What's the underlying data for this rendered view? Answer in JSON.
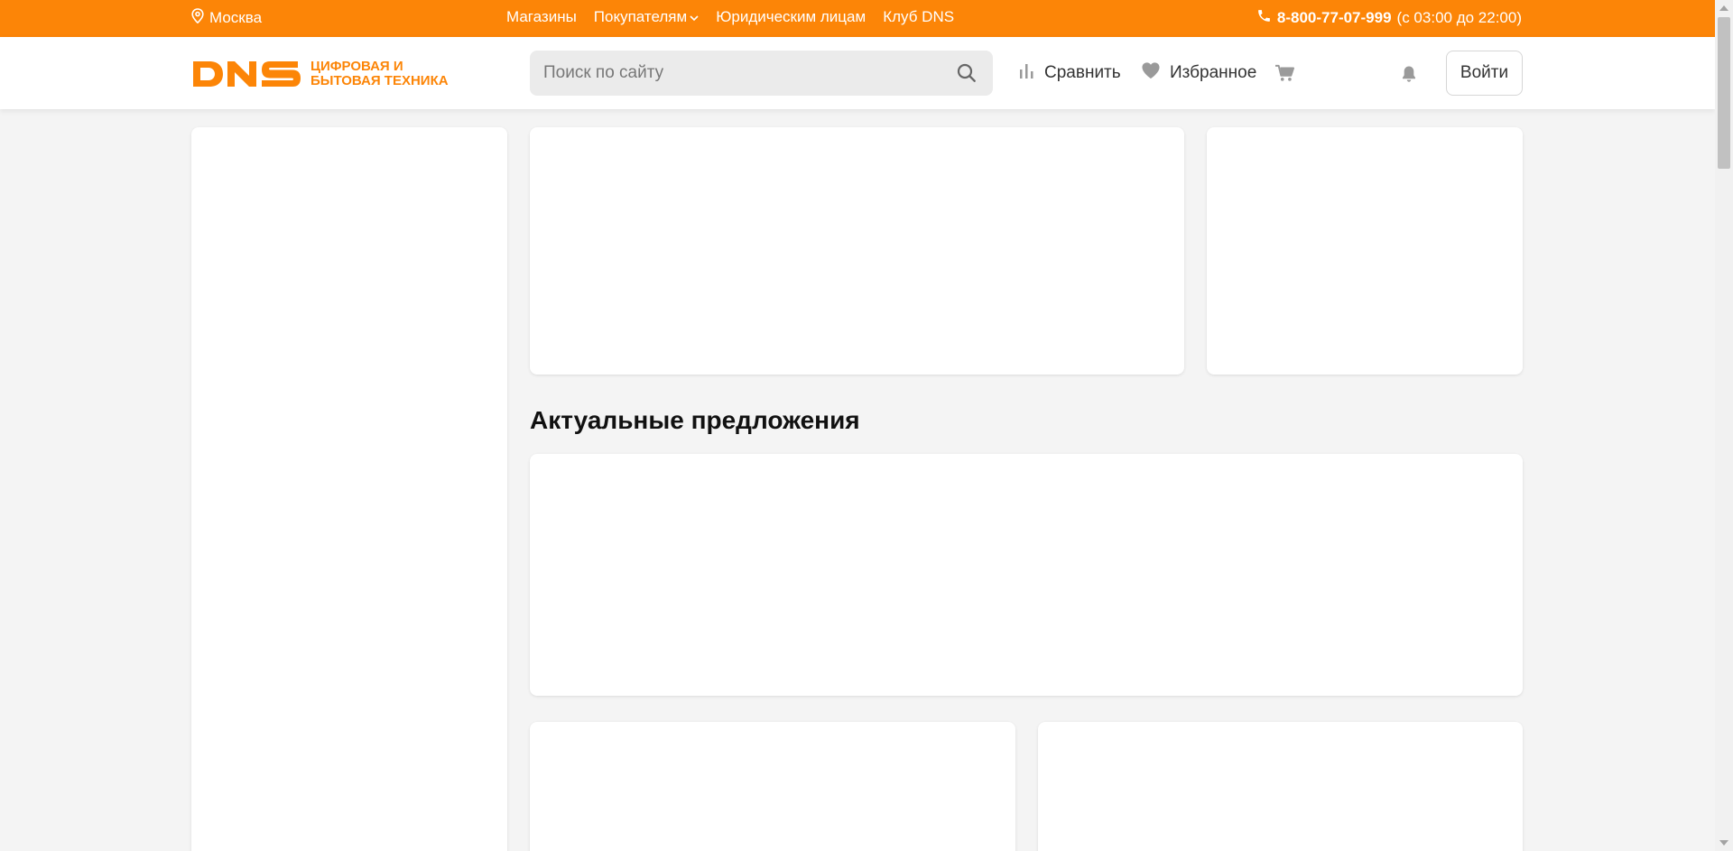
{
  "topbar": {
    "city": "Москва",
    "nav": [
      "Магазины",
      "Покупателям",
      "Юридическим лицам",
      "Клуб DNS"
    ],
    "phone": "8-800-77-07-999",
    "hours": "(с 03:00 до 22:00)"
  },
  "header": {
    "logo_short": "DNS",
    "logo_line1": "Цифровая и",
    "logo_line2": "бытовая техника",
    "search_placeholder": "Поиск по сайту",
    "compare_label": "Сравнить",
    "favorites_label": "Избранное",
    "login_label": "Войти"
  },
  "main": {
    "offers_title": "Актуальные предложения"
  },
  "colors": {
    "brand": "#fc8507",
    "background": "#f4f4f4"
  },
  "icons": [
    "location-pin-icon",
    "chevron-down-icon",
    "phone-icon",
    "search-icon",
    "compare-icon",
    "heart-icon",
    "cart-icon",
    "bell-icon"
  ]
}
